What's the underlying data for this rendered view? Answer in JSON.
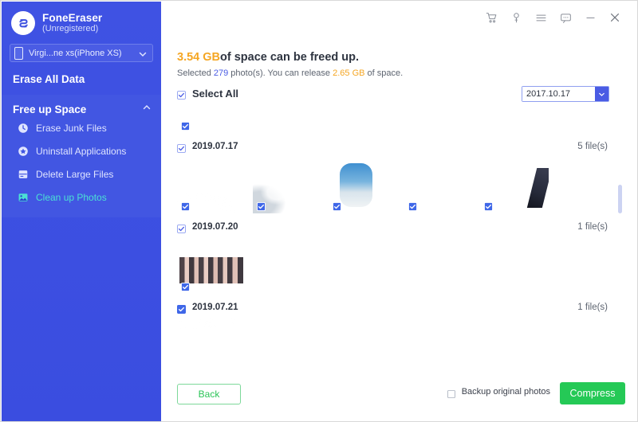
{
  "app": {
    "name": "FoneEraser",
    "registration": "(Unregistered)",
    "device": "Virgi...ne xs(iPhone XS)"
  },
  "titlebar": {
    "buttons": [
      {
        "name": "cart-icon",
        "label": "Buy"
      },
      {
        "name": "key-icon",
        "label": "Register"
      },
      {
        "name": "menu-icon",
        "label": "Menu"
      },
      {
        "name": "feedback-icon",
        "label": "Feedback"
      },
      {
        "name": "minimize-icon",
        "label": "Minimize"
      },
      {
        "name": "close-icon",
        "label": "Close"
      }
    ]
  },
  "sidebar": {
    "erase_all_data": "Erase All Data",
    "free_up_space": "Free up Space",
    "items": [
      {
        "label": "Erase Junk Files",
        "icon": "clock-icon",
        "active": false
      },
      {
        "label": "Uninstall Applications",
        "icon": "app-circle-icon",
        "active": false
      },
      {
        "label": "Delete Large Files",
        "icon": "document-icon",
        "active": false
      },
      {
        "label": "Clean up Photos",
        "icon": "photo-icon",
        "active": true
      }
    ]
  },
  "main": {
    "headline_amount": "3.54 GB",
    "headline_rest": "of space can be freed up.",
    "sub_prefix": "Selected ",
    "sub_count": "279",
    "sub_middle": " photo(s). You can release ",
    "sub_size": "2.65 GB",
    "sub_suffix": " of space.",
    "select_all": "Select All",
    "date_filter_value": "2017.10.17",
    "groups": [
      {
        "date": "",
        "count": "",
        "partial": true,
        "photos": [
          {
            "art": "ph-food",
            "checked": true
          }
        ]
      },
      {
        "date": "2019.07.17",
        "count": "5 file(s)",
        "partial": false,
        "photos": [
          {
            "art": "ph-sky",
            "checked": true
          },
          {
            "art": "ph-clouds",
            "checked": true
          },
          {
            "art": "ph-window",
            "checked": true
          },
          {
            "art": "ph-tray",
            "checked": true
          },
          {
            "art": "ph-wing",
            "checked": true
          }
        ]
      },
      {
        "date": "2019.07.20",
        "count": "1 file(s)",
        "partial": false,
        "photos": [
          {
            "art": "ph-party",
            "checked": true
          }
        ]
      },
      {
        "date": "2019.07.21",
        "count": "1 file(s)",
        "partial": false,
        "photos": [
          {
            "art": "ph-city",
            "checked": true
          }
        ]
      }
    ]
  },
  "footer": {
    "back": "Back",
    "backup_label": "Backup original photos",
    "backup_checked": false,
    "compress": "Compress"
  },
  "colors": {
    "sidebar": "#3c50e0",
    "accent_blue": "#4a5ce4",
    "amber": "#f5a623",
    "green": "#25c956",
    "teal_active": "#4be0d4"
  }
}
